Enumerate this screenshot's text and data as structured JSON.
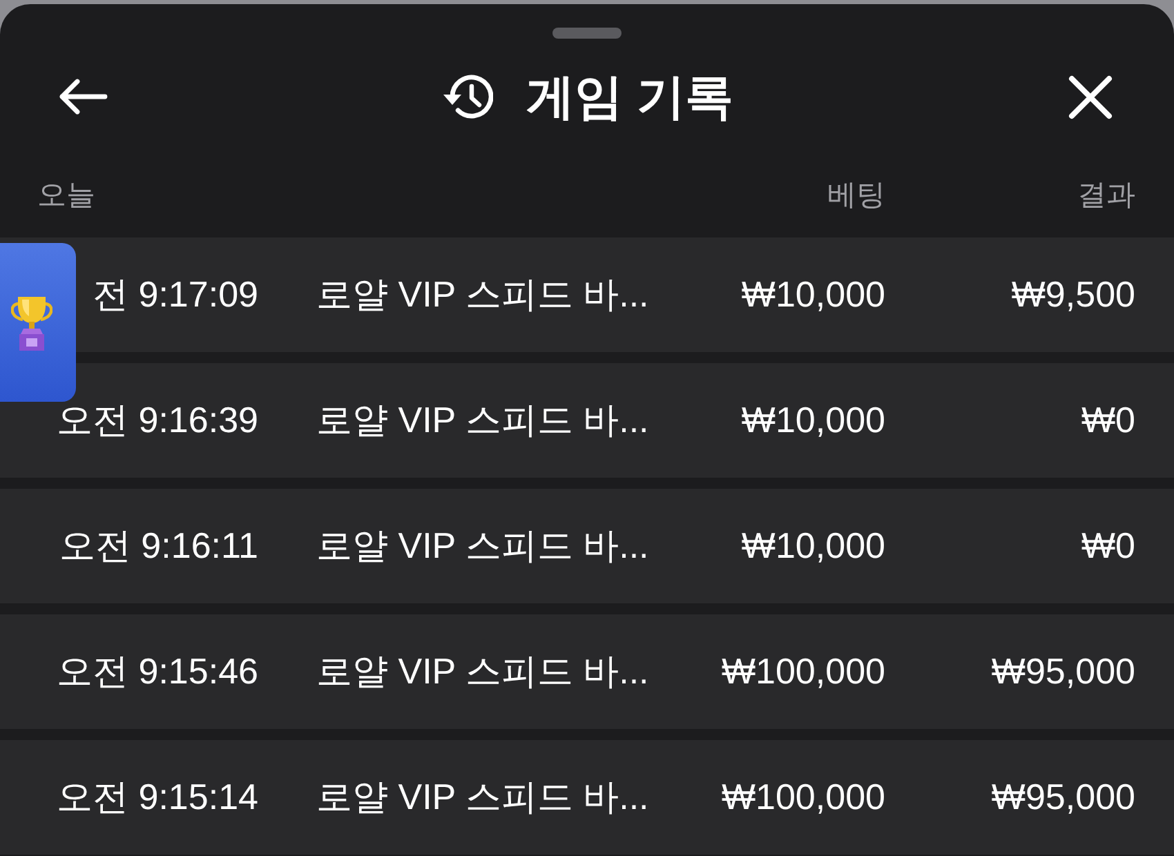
{
  "sheet": {
    "title": "게임 기록"
  },
  "table": {
    "date_heading": "오늘",
    "columns": [
      "베팅",
      "결과"
    ],
    "rows": [
      {
        "time": "전 9:17:09",
        "game": "로얄 VIP 스피드 바...",
        "bet": "₩10,000",
        "result": "₩9,500"
      },
      {
        "time": "오전 9:16:39",
        "game": "로얄 VIP 스피드 바...",
        "bet": "₩10,000",
        "result": "₩0"
      },
      {
        "time": "오전 9:16:11",
        "game": "로얄 VIP 스피드 바...",
        "bet": "₩10,000",
        "result": "₩0"
      },
      {
        "time": "오전 9:15:46",
        "game": "로얄 VIP 스피드 바...",
        "bet": "₩100,000",
        "result": "₩95,000"
      },
      {
        "time": "오전 9:15:14",
        "game": "로얄 VIP 스피드 바...",
        "bet": "₩100,000",
        "result": "₩95,000"
      }
    ]
  }
}
